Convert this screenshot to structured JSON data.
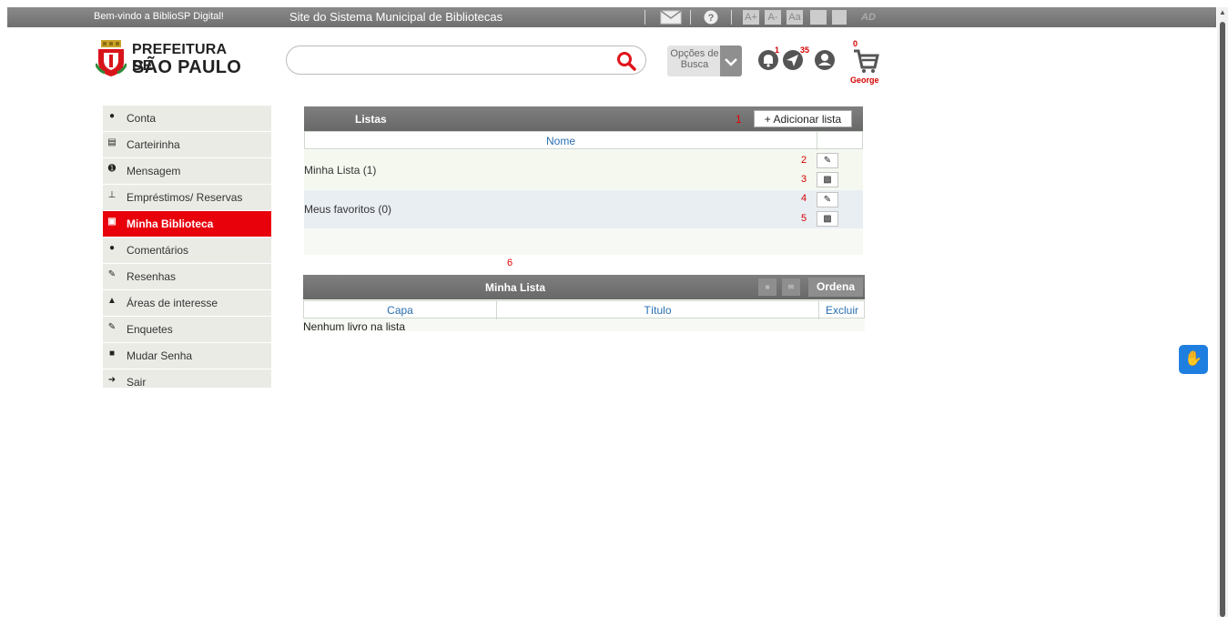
{
  "topbar": {
    "welcome": "Bem-vindo a BiblioSP Digital!",
    "site_title": "Site do Sistema Municipal de Bibliotecas",
    "accessibility": {
      "font_increase": "A+",
      "font_decrease": "A-",
      "font_reset": "Aa",
      "ad": "AD"
    }
  },
  "header": {
    "logo_line1": "PREFEITURA DE",
    "logo_line2": "SÃO PAULO",
    "search": {
      "value": "",
      "placeholder": ""
    },
    "search_options_label": "Opções de Busca",
    "notifications_badge": "1",
    "messages_badge": "35",
    "cart_badge": "0",
    "user_name": "George"
  },
  "sidebar": {
    "items": [
      {
        "label": "Conta",
        "icon": "user-icon"
      },
      {
        "label": "Carteirinha",
        "icon": "card-icon"
      },
      {
        "label": "Mensagem",
        "icon": "info-icon"
      },
      {
        "label": "Empréstimos/ Reservas",
        "icon": "pin-icon"
      },
      {
        "label": "Minha Biblioteca",
        "icon": "book-icon",
        "active": true
      },
      {
        "label": "Comentários",
        "icon": "comment-icon"
      },
      {
        "label": "Resenhas",
        "icon": "pencil-icon"
      },
      {
        "label": "Áreas de interesse",
        "icon": "thumbs-up-icon"
      },
      {
        "label": "Enquetes",
        "icon": "edit-icon"
      },
      {
        "label": "Mudar Senha",
        "icon": "lock-icon"
      },
      {
        "label": "Sair",
        "icon": "sign-out-icon"
      }
    ],
    "active_color": "#e8000b"
  },
  "listas": {
    "title": "Listas",
    "marker_add": "1",
    "add_button": "+ Adicionar lista",
    "column_name": "Nome",
    "rows": [
      {
        "name": "Minha Lista (1)",
        "edit_marker": "2",
        "delete_marker": "3"
      },
      {
        "name": "Meus favoritos (0)",
        "edit_marker": "4",
        "delete_marker": "5"
      }
    ],
    "edit_icon": "pencil-icon",
    "delete_icon": "trash-icon"
  },
  "minha_lista": {
    "marker": "6",
    "title": "Minha Lista",
    "order_button": "Ordena",
    "columns": {
      "cover": "Capa",
      "title": "Título",
      "delete": "Excluir"
    },
    "empty_text": "Nenhum livro na lista"
  },
  "colors": {
    "header_gray": "#6f6f6f",
    "link_blue": "#2a6fb0",
    "marker_red": "#e80000",
    "libras_blue": "#1f7fe0"
  }
}
